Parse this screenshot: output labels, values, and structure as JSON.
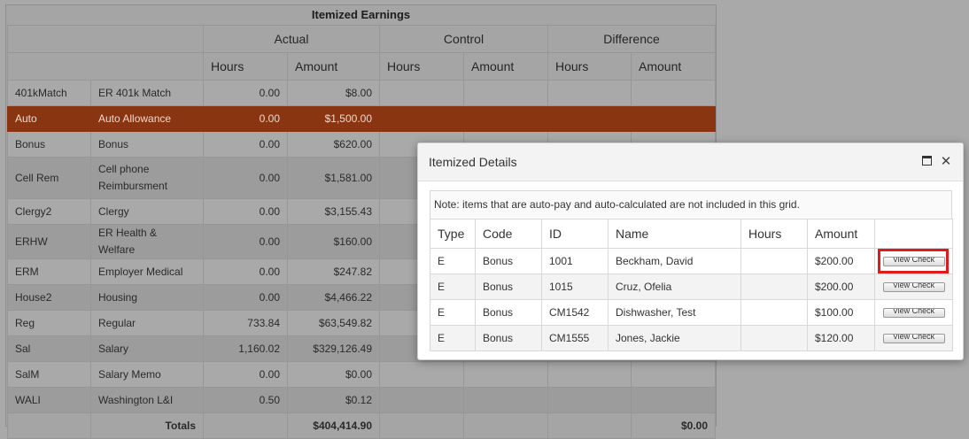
{
  "earnings": {
    "title": "Itemized Earnings",
    "group_headers": [
      "Actual",
      "Control",
      "Difference"
    ],
    "sub_headers": [
      "Hours",
      "Amount",
      "Hours",
      "Amount",
      "Hours",
      "Amount"
    ],
    "rows": [
      {
        "code": "401kMatch",
        "desc": "ER 401k Match",
        "hours": "0.00",
        "amount": "$8.00"
      },
      {
        "code": "Auto",
        "desc": "Auto Allowance",
        "hours": "0.00",
        "amount": "$1,500.00",
        "selected": true
      },
      {
        "code": "Bonus",
        "desc": "Bonus",
        "hours": "0.00",
        "amount": "$620.00"
      },
      {
        "code": "Cell Rem",
        "desc": "Cell phone Reimbursment",
        "hours": "0.00",
        "amount": "$1,581.00"
      },
      {
        "code": "Clergy2",
        "desc": "Clergy",
        "hours": "0.00",
        "amount": "$3,155.43"
      },
      {
        "code": "ERHW",
        "desc": "ER Health & Welfare",
        "hours": "0.00",
        "amount": "$160.00"
      },
      {
        "code": "ERM",
        "desc": "Employer Medical",
        "hours": "0.00",
        "amount": "$247.82"
      },
      {
        "code": "House2",
        "desc": "Housing",
        "hours": "0.00",
        "amount": "$4,466.22"
      },
      {
        "code": "Reg",
        "desc": "Regular",
        "hours": "733.84",
        "amount": "$63,549.82"
      },
      {
        "code": "Sal",
        "desc": "Salary",
        "hours": "1,160.02",
        "amount": "$329,126.49"
      },
      {
        "code": "SalM",
        "desc": "Salary Memo",
        "hours": "0.00",
        "amount": "$0.00"
      },
      {
        "code": "WALI",
        "desc": "Washington L&I",
        "hours": "0.50",
        "amount": "$0.12"
      }
    ],
    "totals": {
      "label": "Totals",
      "actual_amount": "$404,414.90",
      "difference_amount": "$0.00"
    }
  },
  "dialog": {
    "title": "Itemized Details",
    "maximize_icon": "maximize-icon",
    "close_icon": "close-icon",
    "close_glyph": "✕",
    "note": "Note: items that are auto-pay and auto-calculated are not included in this grid.",
    "columns": [
      "Type",
      "Code",
      "ID",
      "Name",
      "Hours",
      "Amount",
      ""
    ],
    "rows": [
      {
        "type": "E",
        "code": "Bonus",
        "id": "1001",
        "name": "Beckham, David",
        "hours": "",
        "amount": "$200.00",
        "button": "View Check"
      },
      {
        "type": "E",
        "code": "Bonus",
        "id": "1015",
        "name": "Cruz, Ofelia",
        "hours": "",
        "amount": "$200.00",
        "button": "View Check"
      },
      {
        "type": "E",
        "code": "Bonus",
        "id": "CM1542",
        "name": "Dishwasher, Test",
        "hours": "",
        "amount": "$100.00",
        "button": "View Check"
      },
      {
        "type": "E",
        "code": "Bonus",
        "id": "CM1555",
        "name": "Jones, Jackie",
        "hours": "",
        "amount": "$120.00",
        "button": "View Check"
      }
    ],
    "highlight_color": "#e01a1a"
  },
  "colors": {
    "selected_row": "#8a3512",
    "overlay": "#a9a9a9"
  }
}
